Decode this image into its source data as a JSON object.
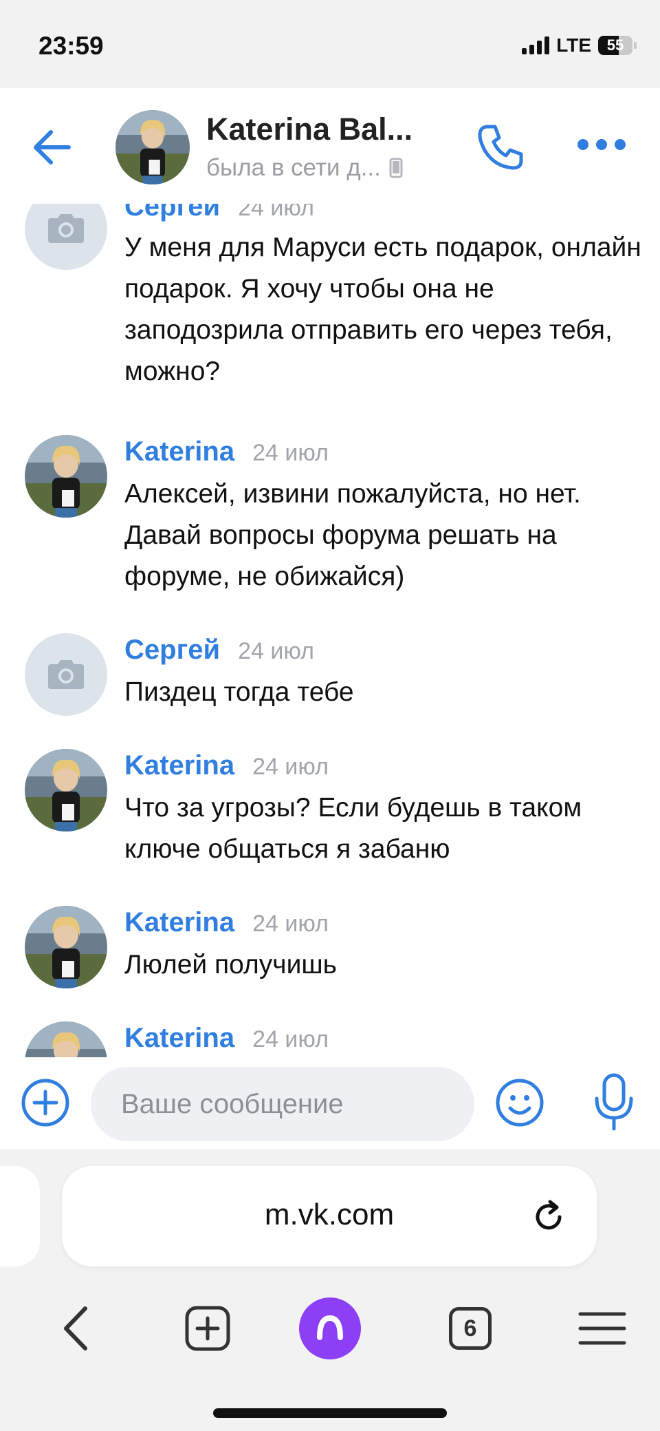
{
  "status_bar": {
    "time": "23:59",
    "network": "LTE",
    "battery": "55"
  },
  "header": {
    "contact_name": "Katerina Bal...",
    "contact_status": "была в сети д...",
    "icons": [
      "back-arrow-icon",
      "phone-icon",
      "more-icon",
      "mobile-device-icon"
    ],
    "accent_color": "#2f7ee0"
  },
  "messages": [
    {
      "author": "Сергей",
      "date": "24 июл",
      "avatar": "camera-placeholder",
      "text": "У меня для Маруси есть подарок, онлайн подарок. Я хочу чтобы она не заподозрила отправить его через тебя, можно?"
    },
    {
      "author": "Katerina",
      "date": "24 июл",
      "avatar": "photo",
      "text": "Алексей, извини пожалуйста, но нет. Давай вопросы форума решать на форуме, не обижайся)"
    },
    {
      "author": "Сергей",
      "date": "24 июл",
      "avatar": "camera-placeholder",
      "text": "Пиздец тогда тебе"
    },
    {
      "author": "Katerina",
      "date": "24 июл",
      "avatar": "photo",
      "text": "Что за угрозы? Если будешь в таком ключе общаться я забаню"
    },
    {
      "author": "Katerina",
      "date": "24 июл",
      "avatar": "photo",
      "text": "Люлей получишь"
    },
    {
      "author": "Katerina",
      "date": "24 июл",
      "avatar": "photo",
      "text": ""
    }
  ],
  "composer": {
    "placeholder": "Ваше сообщение",
    "value": ""
  },
  "browser": {
    "url": "m.vk.com",
    "tab_count": "6",
    "alice_color": "#8c3ff5"
  }
}
